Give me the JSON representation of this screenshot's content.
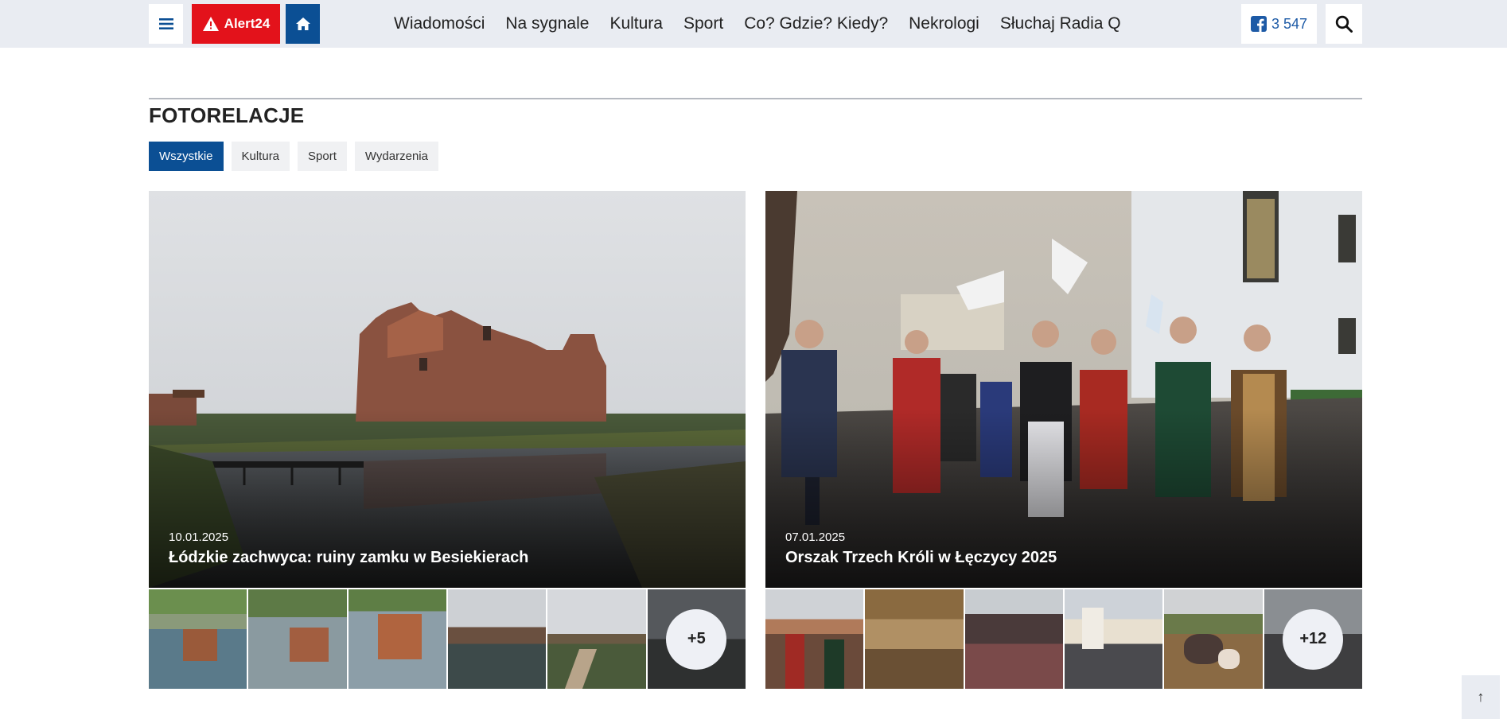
{
  "header": {
    "alert_label": "Alert24",
    "nav": [
      "Wiadomości",
      "Na sygnale",
      "Kultura",
      "Sport",
      "Co? Gdzie? Kiedy?",
      "Nekrologi",
      "Słuchaj Radia Q"
    ],
    "fb_count": "3 547",
    "colors": {
      "alert": "#e3121b",
      "accent": "#0b4f94"
    }
  },
  "section": {
    "title": "FOTORELACJE",
    "filters": [
      "Wszystkie",
      "Kultura",
      "Sport",
      "Wydarzenia"
    ],
    "active_filter": "Wszystkie"
  },
  "galleries": [
    {
      "date": "10.01.2025",
      "title": "Łódzkie zachwyca: ruiny zamku w Besiekierach",
      "more": "+5"
    },
    {
      "date": "07.01.2025",
      "title": "Orszak Trzech Króli w Łęczycy 2025",
      "more": "+12"
    }
  ],
  "icons": {
    "menu": "hamburger-icon",
    "alert": "warning-icon",
    "home": "home-icon",
    "facebook": "facebook-icon",
    "search": "search-icon",
    "scroll_top": "arrow-up-icon"
  },
  "scroll_top_label": "↑"
}
